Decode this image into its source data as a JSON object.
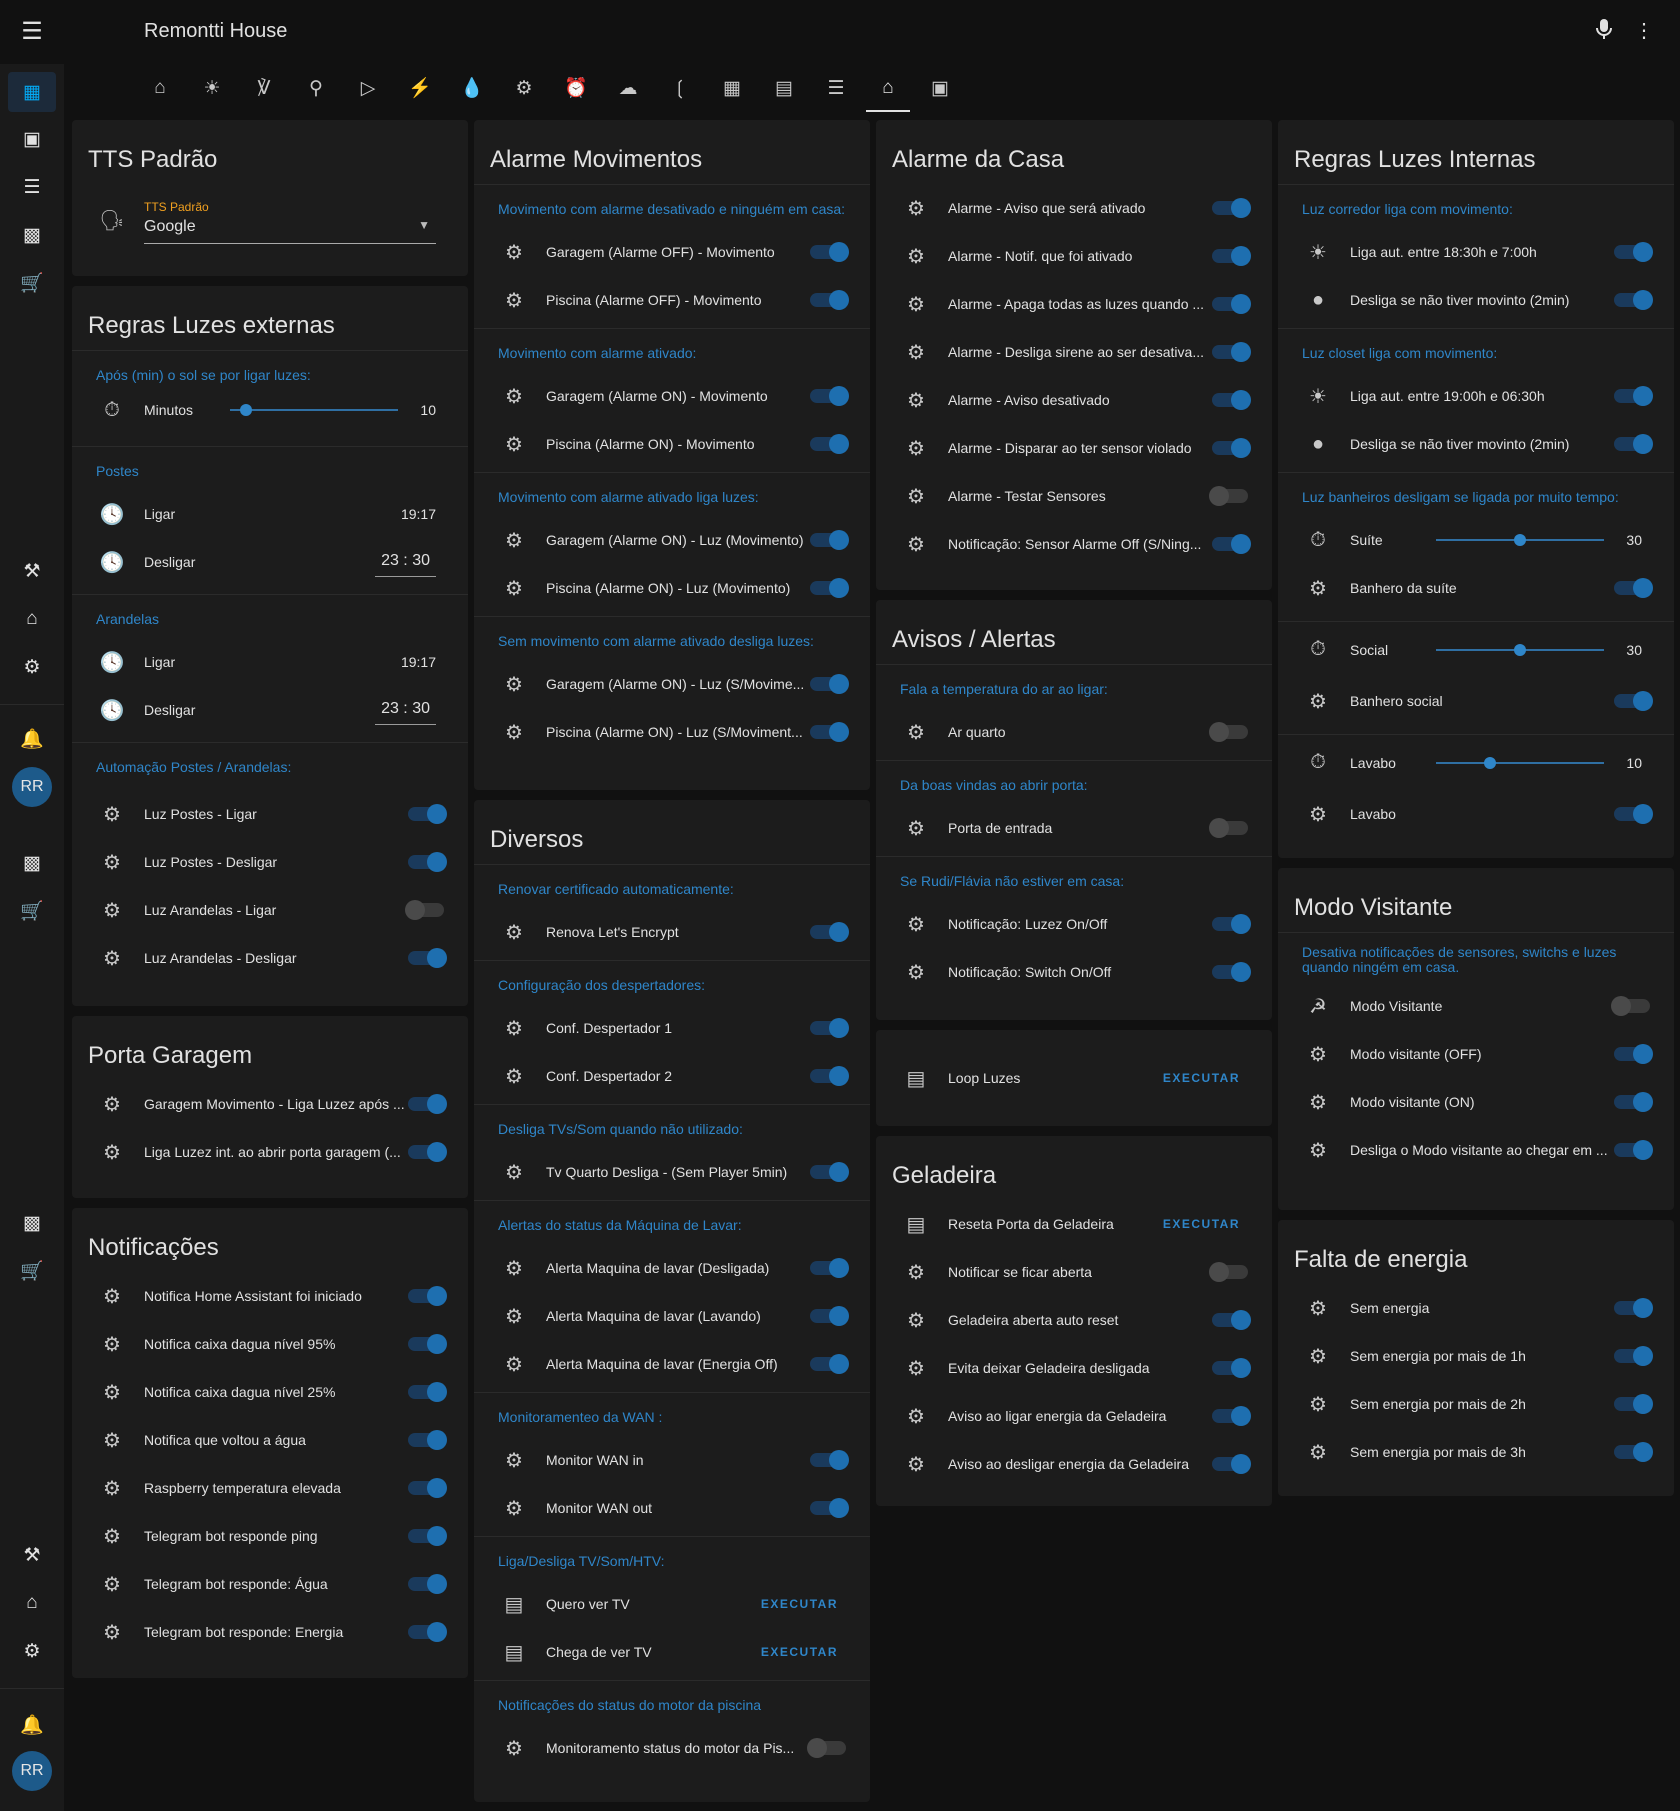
{
  "app": {
    "title": "Remontti House"
  },
  "header": {
    "menu_icon": "menu-icon",
    "mic_icon": "microphone-icon",
    "more_icon": "more-vert-icon"
  },
  "tabs": [
    "home-automation-icon",
    "lightbulb-icon",
    "remote-icon",
    "cctv-icon",
    "play-circle-icon",
    "power-plug-icon",
    "water-icon",
    "cog-refresh-icon",
    "alarm-clock-icon",
    "weather-icon",
    "signal-icon",
    "floor-plan-icon",
    "tv-guide-icon",
    "script-icon",
    "home-icon",
    "cast-icon"
  ],
  "sidebar": {
    "avatar1": "RR",
    "avatar2": "RR"
  },
  "tts": {
    "title": "TTS Padrão",
    "select_label": "TTS Padrão",
    "select_value": "Google"
  },
  "ext": {
    "title": "Regras Luzes externas",
    "sec1": "Após (min) o sol se por ligar luzes:",
    "minutos_label": "Minutos",
    "minutos_value": "10",
    "minutos_level": 0.12,
    "sec2": "Postes",
    "p_ligar": "Ligar",
    "p_ligar_val": "19:17",
    "p_desligar": "Desligar",
    "p_desligar_val": "23 : 30",
    "sec3": "Arandelas",
    "a_ligar": "Ligar",
    "a_ligar_val": "19:17",
    "a_desligar": "Desligar",
    "a_desligar_val": "23 : 30",
    "sec4": "Automação Postes / Arandelas:",
    "r1": "Luz Postes - Ligar",
    "r2": "Luz Postes - Desligar",
    "r3": "Luz Arandelas - Ligar",
    "r4": "Luz Arandelas - Desligar"
  },
  "garagem": {
    "title": "Porta Garagem",
    "r1": "Garagem Movimento - Liga Luzez após ...",
    "r2": "Liga Luzez int. ao abrir porta garagem (..."
  },
  "notif": {
    "title": "Notificações",
    "items": [
      "Notifica Home Assistant foi iniciado",
      "Notifica caixa dagua nível 95%",
      "Notifica caixa dagua nível 25%",
      "Notifica que voltou a água",
      "Raspberry temperatura elevada",
      "Telegram bot responde ping",
      "Telegram bot responde: Água",
      "Telegram bot responde: Energia"
    ]
  },
  "alarmemov": {
    "title": "Alarme Movimentos",
    "s1": "Movimento com alarme desativado e ninguém em casa:",
    "s1r1": "Garagem (Alarme OFF) - Movimento",
    "s1r2": "Piscina (Alarme OFF) - Movimento",
    "s2": "Movimento com alarme ativado:",
    "s2r1": "Garagem (Alarme ON) - Movimento",
    "s2r2": "Piscina (Alarme ON) - Movimento",
    "s3": "Movimento com alarme ativado liga luzes:",
    "s3r1": "Garagem (Alarme ON) - Luz (Movimento)",
    "s3r2": "Piscina (Alarme ON) - Luz (Movimento)",
    "s4": "Sem movimento com alarme ativado desliga luzes:",
    "s4r1": "Garagem (Alarme ON) - Luz (S/Movime...",
    "s4r2": "Piscina (Alarme ON) - Luz (S/Moviment..."
  },
  "diversos": {
    "title": "Diversos",
    "s1": "Renovar certificado automaticamente:",
    "s1r1": "Renova Let's Encrypt",
    "s2": "Configuração dos despertadores:",
    "s2r1": "Conf. Despertador 1",
    "s2r2": "Conf. Despertador 2",
    "s3": "Desliga TVs/Som quando não utilizado:",
    "s3r1": "Tv Quarto Desliga - (Sem Player 5min)",
    "s4": "Alertas do status da Máquina de Lavar:",
    "s4r1": "Alerta Maquina de lavar (Desligada)",
    "s4r2": "Alerta Maquina de lavar (Lavando)",
    "s4r3": "Alerta Maquina de lavar (Energia Off)",
    "s5": "Monitoramenteo da WAN :",
    "s5r1": "Monitor WAN in",
    "s5r2": "Monitor WAN out",
    "s6": "Liga/Desliga TV/Som/HTV:",
    "s6r1": "Quero ver TV",
    "s6r2": "Chega de ver TV",
    "exec": "EXECUTAR",
    "s7": "Notificações do status do motor da piscina",
    "s7r1": "Monitoramento status do motor da Pis..."
  },
  "alarmecasa": {
    "title": "Alarme da Casa",
    "items": [
      "Alarme - Aviso que será ativado",
      "Alarme - Notif. que foi ativado",
      "Alarme - Apaga todas as luzes quando ...",
      "Alarme - Desliga sirene ao ser desativa...",
      "Alarme - Aviso desativado",
      "Alarme - Disparar ao ter sensor violado",
      "Alarme - Testar Sensores",
      "Notificação: Sensor Alarme Off (S/Ning..."
    ]
  },
  "avisos": {
    "title": "Avisos / Alertas",
    "s1": "Fala a temperatura do ar ao ligar:",
    "s1r1": "Ar quarto",
    "s2": "Da boas vindas ao abrir porta:",
    "s2r1": "Porta de entrada",
    "s3": "Se Rudi/Flávia não estiver em casa:",
    "s3r1": "Notificação: Luzez On/Off",
    "s3r2": "Notificação: Switch On/Off"
  },
  "loop": {
    "label": "Loop Luzes",
    "exec": "EXECUTAR"
  },
  "geladeira": {
    "title": "Geladeira",
    "r1": "Reseta Porta da Geladeira",
    "exec": "EXECUTAR",
    "items": [
      "Notificar se ficar aberta",
      "Geladeira aberta auto reset",
      "Evita deixar Geladeira desligada",
      "Aviso ao ligar energia da Geladeira",
      "Aviso ao desligar energia da Geladeira"
    ]
  },
  "internas": {
    "title": "Regras Luzes Internas",
    "s1": "Luz corredor liga com movimento:",
    "s1r1": "Liga aut. entre 18:30h e 7:00h",
    "s1r2": "Desliga se não tiver movinto (2min)",
    "s2": "Luz closet liga com movimento:",
    "s2r1": "Liga aut. entre 19:00h e 06:30h",
    "s2r2": "Desliga se não tiver movinto (2min)",
    "s3": "Luz banheiros desligam se ligada por muito tempo:",
    "suite": "Suíte",
    "suite_val": "30",
    "suite_level": 0.5,
    "banho_suite": "Banhero da suíte",
    "social": "Social",
    "social_val": "30",
    "social_level": 0.5,
    "banho_social": "Banhero social",
    "lavabo": "Lavabo",
    "lavabo_val": "10",
    "lavabo_level": 0.33,
    "lavabo2": "Lavabo"
  },
  "visitante": {
    "title": "Modo Visitante",
    "sec": "Desativa notificações de sensores, switchs e luzes quando ningém em casa.",
    "r0": "Modo Visitante",
    "items": [
      "Modo visitante (OFF)",
      "Modo visitante (ON)",
      "Desliga o Modo visitante ao chegar em ..."
    ]
  },
  "energia": {
    "title": "Falta de energia",
    "items": [
      "Sem energia",
      "Sem energia por mais de 1h",
      "Sem energia por mais de 2h",
      "Sem energia por mais de 3h"
    ]
  }
}
